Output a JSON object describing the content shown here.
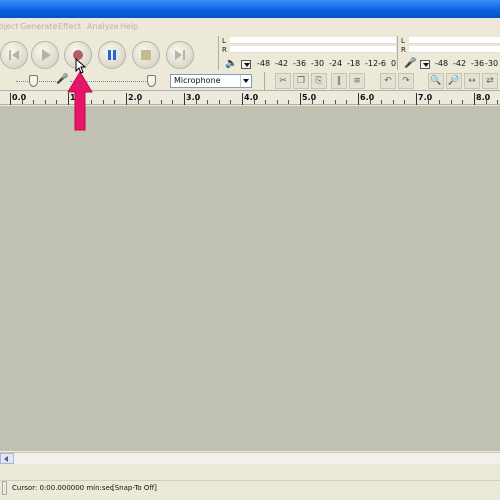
{
  "menubar": {
    "items": [
      "Project",
      "Generate",
      "Effect",
      "Analyze",
      "Help"
    ]
  },
  "transport": {
    "buttons": [
      {
        "name": "skip-to-start",
        "icon": "skip-start-icon"
      },
      {
        "name": "play",
        "icon": "play-icon"
      },
      {
        "name": "record",
        "icon": "record-icon"
      },
      {
        "name": "pause",
        "icon": "pause-icon"
      },
      {
        "name": "stop",
        "icon": "stop-icon"
      },
      {
        "name": "skip-to-end",
        "icon": "skip-end-icon"
      }
    ]
  },
  "meters": {
    "left_channel": "L",
    "right_channel": "R",
    "playback_ticks": [
      "-48",
      "-42",
      "-36",
      "-30",
      "-24",
      "-18",
      "-12",
      "-6",
      "0"
    ],
    "record_ticks": [
      "-48",
      "-42",
      "-36",
      "-30"
    ],
    "playback_icon": "speaker-icon",
    "record_icon": "microphone-icon"
  },
  "mixer": {
    "input_source": "Microphone"
  },
  "ruler": {
    "labels": [
      "0.0",
      "1.0",
      "2.0",
      "3.0",
      "4.0",
      "5.0",
      "6.0",
      "7.0",
      "8.0"
    ]
  },
  "statusbar": {
    "cursor_text": "Cursor: 0:00.000000 min:sec",
    "snap_text": "[Snap-To Off]"
  },
  "colors": {
    "titlebar": "#0a5fe0",
    "track_area": "#c0c1b3",
    "arrow": "#e6156a",
    "record": "#b25e62",
    "pause": "#2b62d9"
  }
}
